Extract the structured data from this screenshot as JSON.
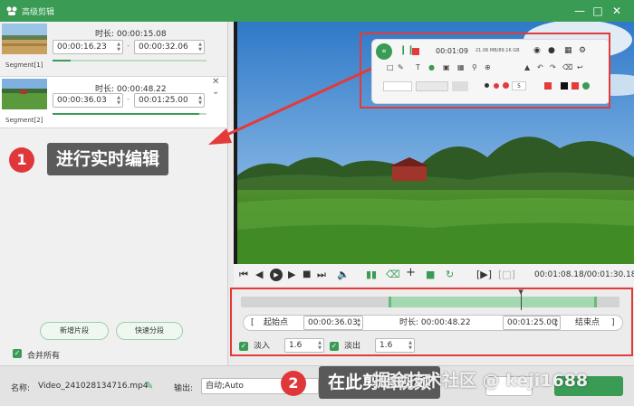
{
  "window": {
    "title": "高级剪辑",
    "accent": "#3a9b55",
    "controls": [
      "minimize-icon",
      "maximize-icon",
      "close-icon"
    ]
  },
  "segments": [
    {
      "label": "Segment[1]",
      "duration": "时长: 00:00:15.08",
      "start": "00:00:16.23",
      "end": "00:00:32.06",
      "progress": 0.12
    },
    {
      "label": "Segment[2]",
      "duration": "时长: 00:00:48.22",
      "start": "00:00:36.03",
      "end": "00:01:25.00",
      "progress": 0.95
    }
  ],
  "left_buttons": {
    "new_segment": "新增片段",
    "quick_split": "快速分段"
  },
  "merge_all": "合并所有",
  "callouts": {
    "one_number": "1",
    "one_text": "进行实时编辑",
    "two_number": "2",
    "two_text": "在此剪辑视频"
  },
  "mini_toolbar": {
    "timer": "00:01:09",
    "size_info": "21.06 MB/89.16 GB",
    "width_value": "5"
  },
  "player": {
    "timecode": "00:01:08.18/00:01:30.18"
  },
  "editor": {
    "start_label": "起始点",
    "start_value": "00:00:36.03",
    "duration_label": "时长: 00:00:48.22",
    "end_value": "00:01:25.00",
    "end_label": "结束点",
    "fade_in_label": "淡入",
    "fade_in_value": "1.6",
    "fade_out_label": "淡出",
    "fade_out_value": "1.6",
    "selection_start": 0.39,
    "selection_end": 0.94,
    "playhead": 0.74
  },
  "bottom": {
    "name_label": "名称:",
    "file_name": "Video_241028134716.mp4",
    "output_label": "输出:",
    "output_value": "自动;Auto",
    "watermark": "掘金技术社区 @ keji1688"
  }
}
